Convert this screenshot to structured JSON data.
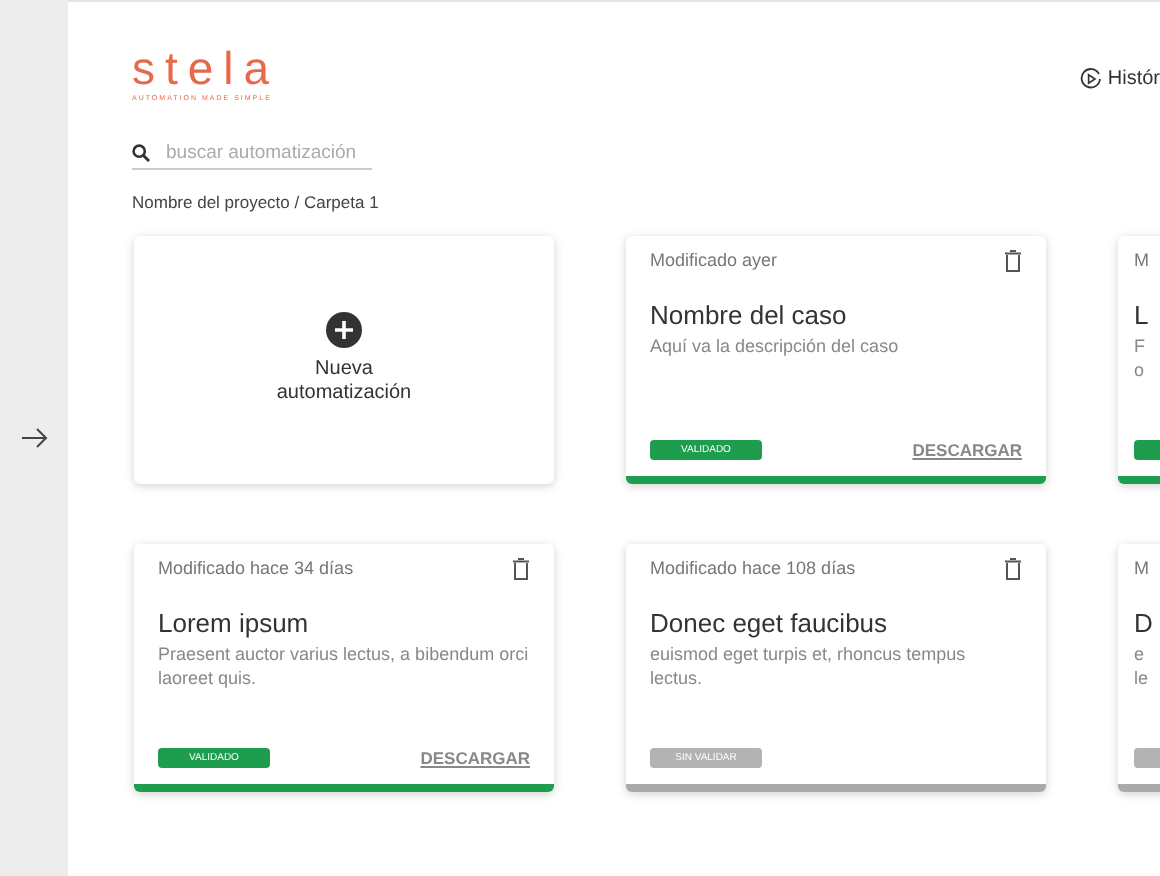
{
  "sidebar": {
    "collapsed": true
  },
  "header": {
    "logo": "stela",
    "tagline": "AUTOMATION MADE SIMPLE",
    "history_button": "Histór"
  },
  "search": {
    "placeholder": "buscar automatización"
  },
  "breadcrumb": "Nombre del proyecto / Carpeta 1",
  "cards": [
    {
      "kind": "new",
      "label": "Nueva\nautomatización"
    },
    {
      "kind": "case",
      "modified": "Modificado ayer",
      "title": "Nombre del caso",
      "description": "Aquí va la descripción del caso",
      "validated": true,
      "badge": "VALIDADO",
      "download": "DESCARGAR"
    },
    {
      "kind": "cut",
      "modified": "M",
      "title": "L",
      "description_lines": [
        "F",
        "o"
      ],
      "validated": true
    },
    {
      "kind": "case",
      "modified": "Modificado hace 34 días",
      "title": "Lorem ipsum",
      "description": "Praesent auctor varius lectus, a bibendum orci laoreet quis.",
      "validated": true,
      "badge": "VALIDADO",
      "download": "DESCARGAR"
    },
    {
      "kind": "case",
      "modified": "Modificado hace 108 días",
      "title": "Donec eget faucibus",
      "description": "euismod eget turpis et, rhoncus tempus lectus.",
      "validated": false,
      "badge": "SIN VALIDAR"
    },
    {
      "kind": "cut",
      "modified": "M",
      "title": "D",
      "description_lines": [
        "e",
        "le"
      ],
      "validated": false
    }
  ]
}
